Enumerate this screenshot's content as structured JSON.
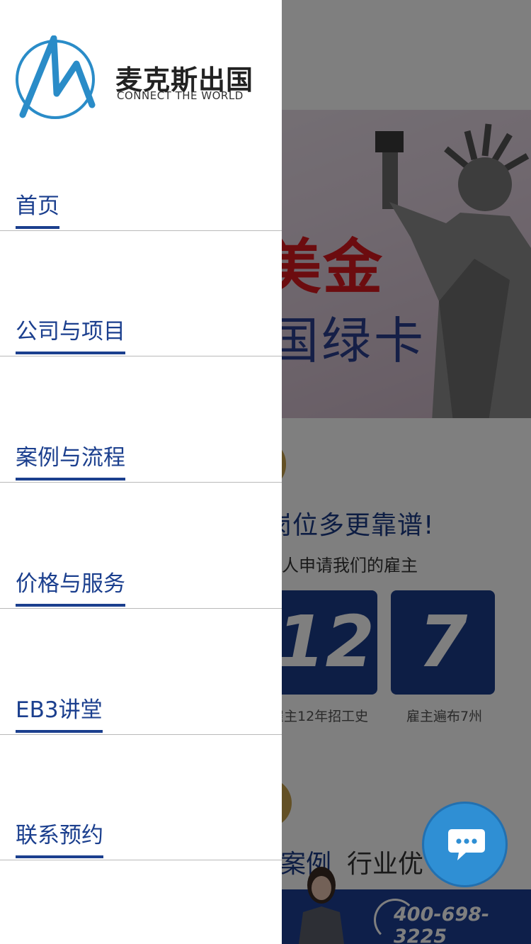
{
  "brand": {
    "name": "麦克斯出国",
    "tagline": "CONNECT THE WORLD",
    "accent_color": "#1b3f8e",
    "logo_color": "#2a8cc8"
  },
  "nav": {
    "items": [
      {
        "label": "首页"
      },
      {
        "label": "公司与项目"
      },
      {
        "label": "案例与流程"
      },
      {
        "label": "价格与服务"
      },
      {
        "label": "EB3讲堂"
      },
      {
        "label": "联系预约"
      }
    ]
  },
  "background": {
    "hero": {
      "line1": "美金",
      "line2": "国绿卡"
    },
    "headline": "岗位多更靠谱!",
    "subline": "人申请我们的雇主",
    "stats": [
      {
        "value": "12",
        "caption": "雇主12年招工史"
      },
      {
        "value": "7",
        "caption": "雇主遍布7州"
      }
    ],
    "tabs": [
      "案例",
      "行业优"
    ],
    "phone": "400-698-3225"
  },
  "chat": {
    "icon": "chat-icon"
  }
}
